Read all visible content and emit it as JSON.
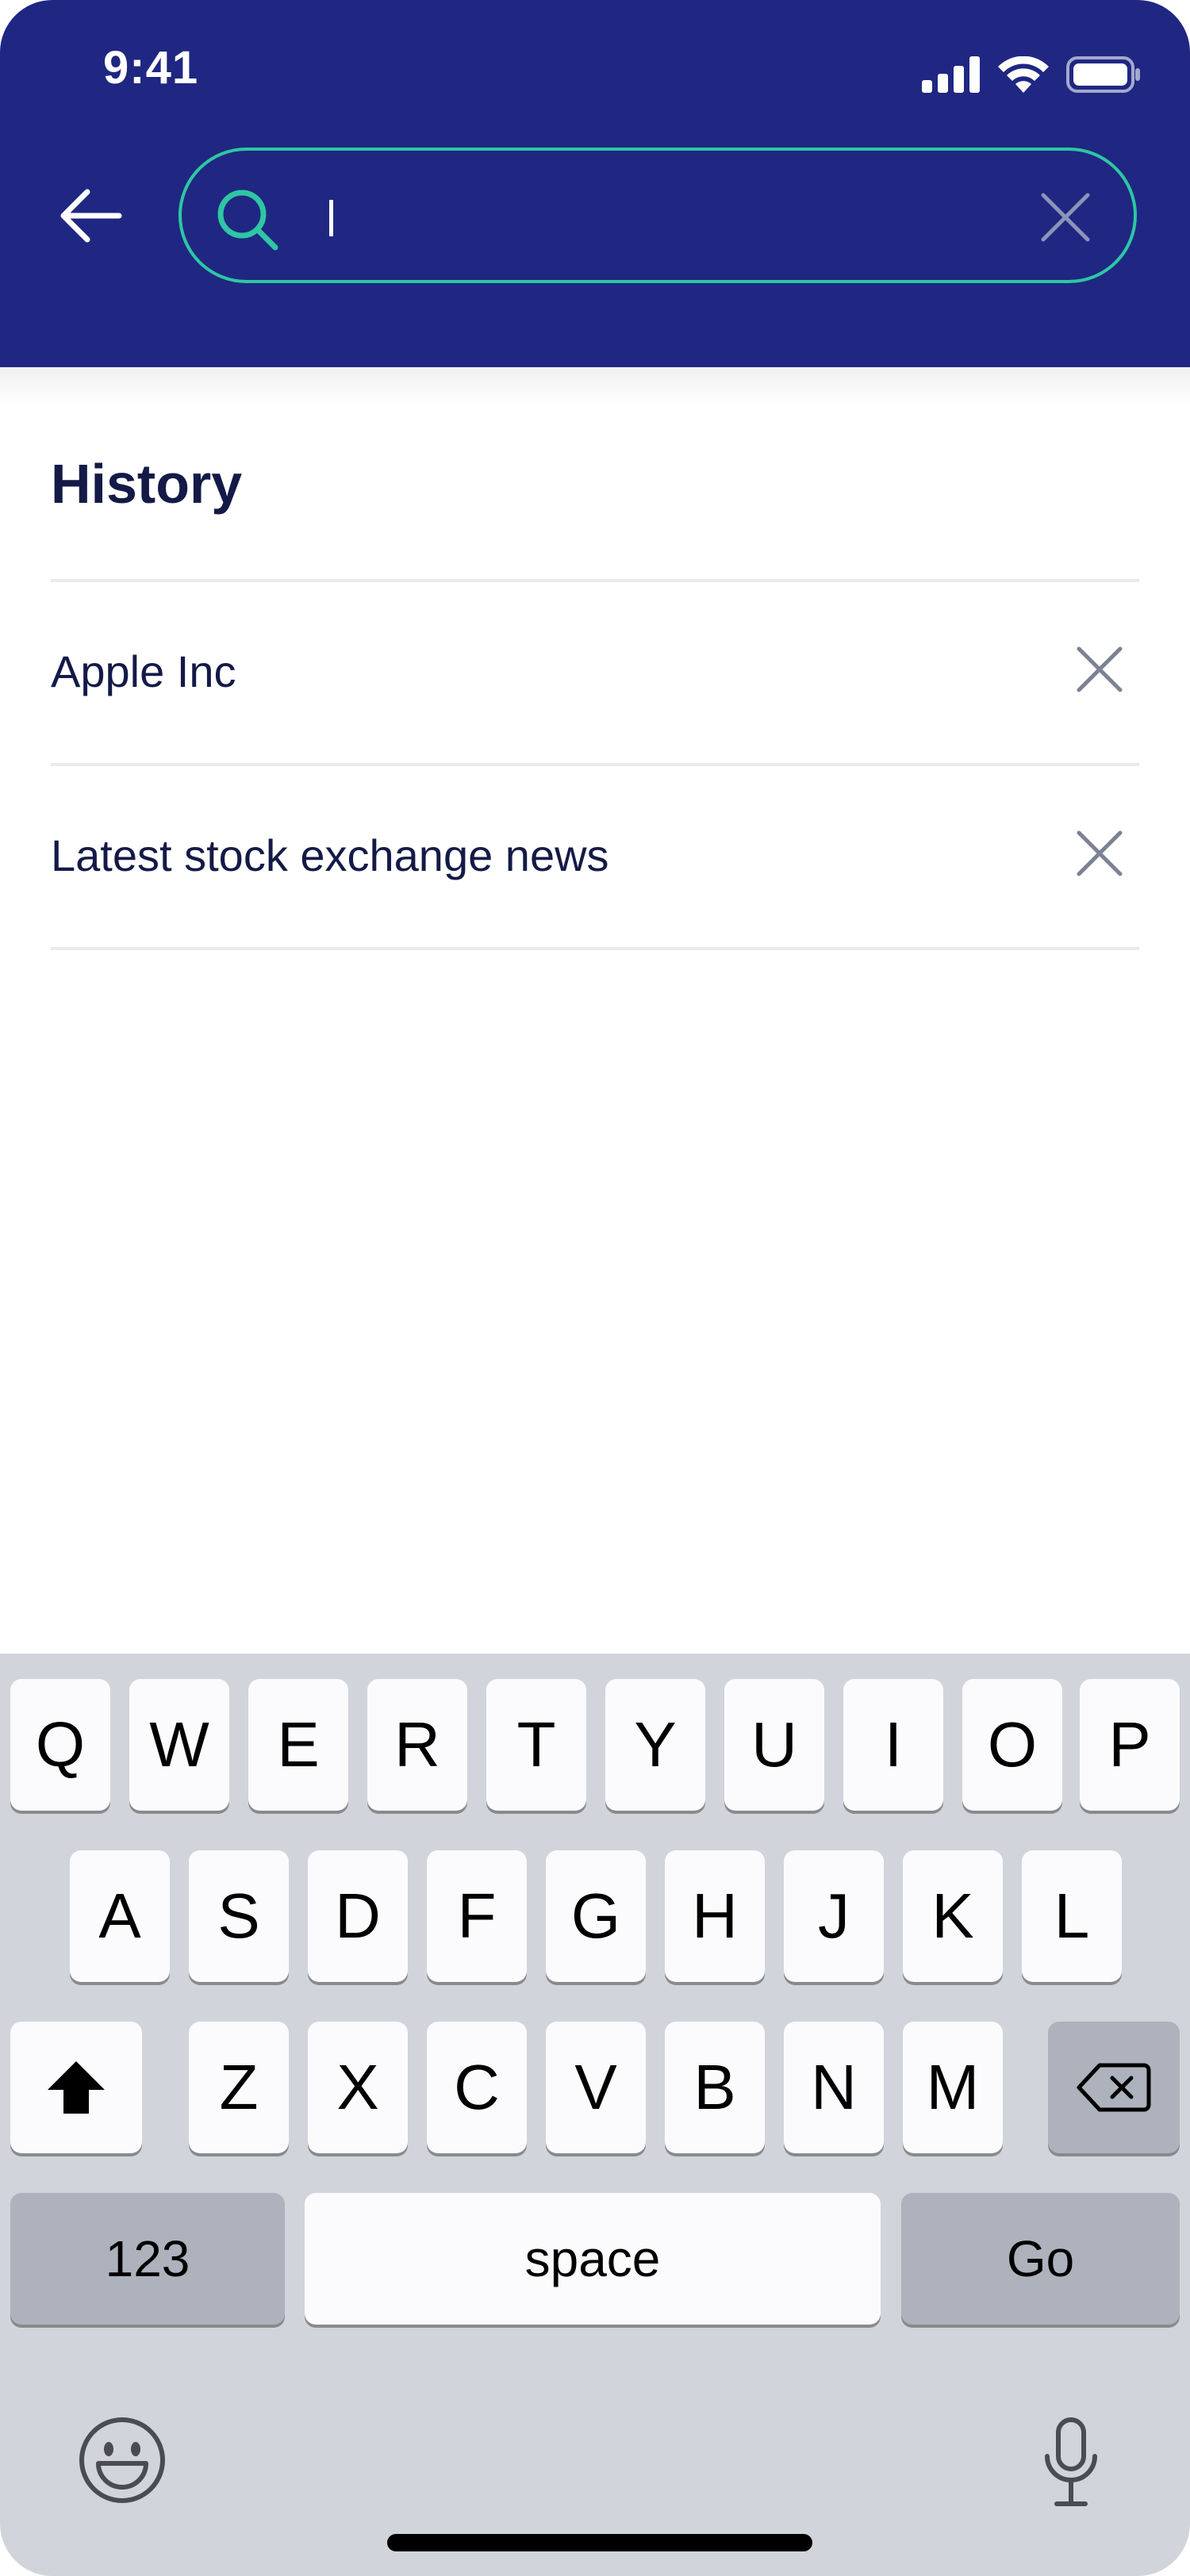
{
  "status_bar": {
    "time": "9:41",
    "icons": [
      "cellular-signal-icon",
      "wifi-icon",
      "battery-icon"
    ]
  },
  "search": {
    "value": "",
    "placeholder": "",
    "back_icon": "arrow-left-icon",
    "clear_icon": "close-icon"
  },
  "history": {
    "title": "History",
    "items": [
      {
        "label": "Apple Inc"
      },
      {
        "label": "Latest stock exchange news"
      }
    ]
  },
  "keyboard": {
    "row1": [
      "Q",
      "W",
      "E",
      "R",
      "T",
      "Y",
      "U",
      "I",
      "O",
      "P"
    ],
    "row2": [
      "A",
      "S",
      "D",
      "F",
      "G",
      "H",
      "J",
      "K",
      "L"
    ],
    "row3": [
      "Z",
      "X",
      "C",
      "V",
      "B",
      "N",
      "M"
    ],
    "numbers_label": "123",
    "space_label": "space",
    "go_label": "Go"
  },
  "colors": {
    "header": "#1f2782",
    "accent": "#2ec6a3",
    "text_primary": "#141a47",
    "keyboard_bg": "#d1d4db"
  }
}
